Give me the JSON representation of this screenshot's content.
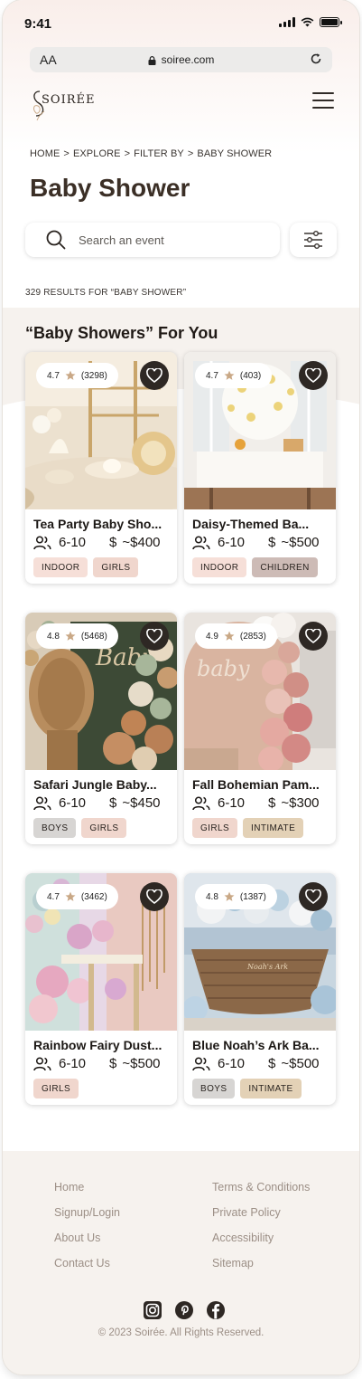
{
  "status_bar": {
    "time": "9:41"
  },
  "browser": {
    "text_size_label": "AA",
    "url": "soiree.com"
  },
  "header": {
    "logo_text": "SOIRÉE"
  },
  "breadcrumb": [
    "HOME",
    "EXPLORE",
    "FILTER BY",
    "BABY SHOWER"
  ],
  "breadcrumb_separator": ">",
  "page_title": "Baby Shower",
  "search": {
    "placeholder": "Search an event"
  },
  "results_text": "329 RESULTS FOR “BABY SHOWER”",
  "section_title": "“Baby Showers” For You",
  "cards": [
    {
      "rating": "4.7",
      "reviews": "(3298)",
      "title": "Tea Party Baby Sho...",
      "guests": "6-10",
      "price": "~$400",
      "tags": [
        {
          "label": "INDOOR",
          "color": "#f6dfd8"
        },
        {
          "label": "GIRLS",
          "color": "#f0d6cd"
        }
      ]
    },
    {
      "rating": "4.7",
      "reviews": "(403)",
      "title": "Daisy-Themed Ba...",
      "guests": "6-10",
      "price": "~$500",
      "tags": [
        {
          "label": "INDOOR",
          "color": "#f6dfd8"
        },
        {
          "label": "CHILDREN",
          "color": "#cdbbb6"
        }
      ]
    },
    {
      "rating": "4.8",
      "reviews": "(5468)",
      "title": "Safari Jungle Baby...",
      "guests": "6-10",
      "price": "~$450",
      "tags": [
        {
          "label": "BOYS",
          "color": "#d7d5d3"
        },
        {
          "label": "GIRLS",
          "color": "#f0d6cd"
        }
      ]
    },
    {
      "rating": "4.9",
      "reviews": "(2853)",
      "title": "Fall Bohemian Pam...",
      "guests": "6-10",
      "price": "~$300",
      "tags": [
        {
          "label": "GIRLS",
          "color": "#f0d6cd"
        },
        {
          "label": "INTIMATE",
          "color": "#e3d1b6"
        }
      ]
    },
    {
      "rating": "4.7",
      "reviews": "(3462)",
      "title": "Rainbow Fairy Dust...",
      "guests": "6-10",
      "price": "~$500",
      "tags": [
        {
          "label": "GIRLS",
          "color": "#f0d6cd"
        }
      ]
    },
    {
      "rating": "4.8",
      "reviews": "(1387)",
      "title": "Blue Noah’s Ark Ba...",
      "guests": "6-10",
      "price": "~$500",
      "tags": [
        {
          "label": "BOYS",
          "color": "#d7d5d3"
        },
        {
          "label": "INTIMATE",
          "color": "#e3d1b6"
        }
      ]
    }
  ],
  "price_symbol": "$",
  "footer": {
    "left_links": [
      "Home",
      "Signup/Login",
      "About Us",
      "Contact Us"
    ],
    "right_links": [
      "Terms & Conditions",
      "Private Policy",
      "Accessibility",
      "Sitemap"
    ],
    "socials": [
      "instagram-icon",
      "pinterest-icon",
      "facebook-icon"
    ],
    "copyright": "© 2023 Soirée. All Rights Reserved."
  },
  "colors": {
    "brand_dark": "#3b2f26",
    "heart_bg": "#2e2824",
    "star": "#c9a886",
    "footer_text": "#9c8f86",
    "band_bg": "#f6f2ee"
  }
}
